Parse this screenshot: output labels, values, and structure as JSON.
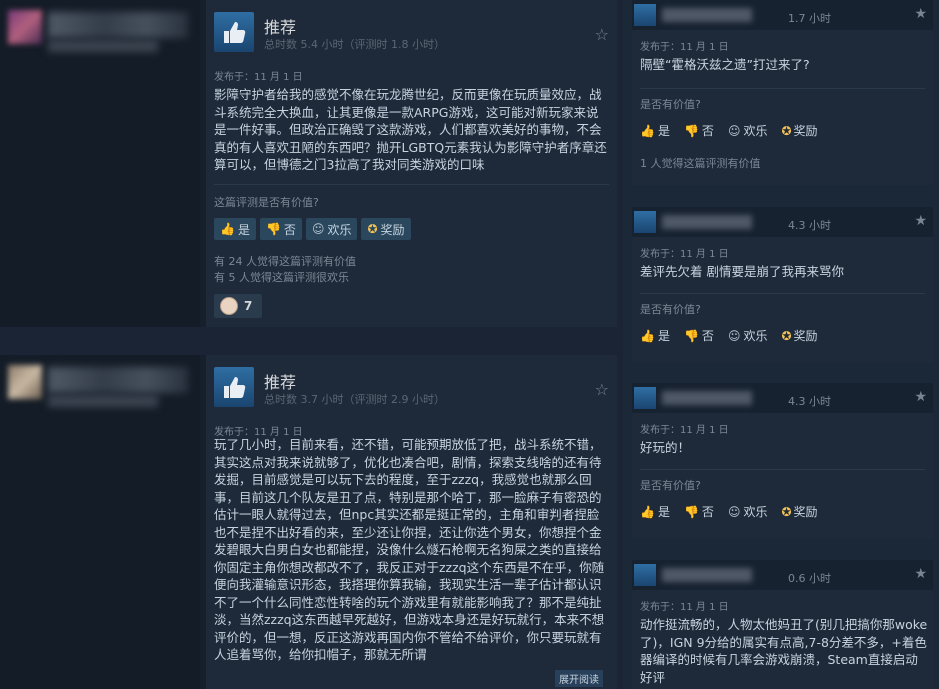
{
  "reviews": [
    {
      "verdict": "推荐",
      "hours": "总时数 5.4 小时（评测时 1.8 小时）",
      "posted": "发布于：11 月 1 日",
      "text": "影障守护者给我的感觉不像在玩龙腾世纪，反而更像在玩质量效应，战斗系统完全大换血，让其更像是一款ARPG游戏，这可能对新玩家来说是一件好事。但政治正确毁了这款游戏，人们都喜欢美好的事物，不会真的有人喜欢丑陋的东西吧？抛开LGBTQ元素我认为影障守护者序章还算可以，但博德之门3拉高了我对同类游戏的口味",
      "helpful_q": "这篇评测是否有价值?",
      "btn_yes": "是",
      "btn_no": "否",
      "btn_funny": "欢乐",
      "btn_award": "奖励",
      "stat1": "有 24 人觉得这篇评测有价值",
      "stat2": "有 5 人觉得这篇评测很欢乐",
      "emoji_count": "7"
    },
    {
      "verdict": "推荐",
      "hours": "总时数 3.7 小时（评测时 2.9 小时）",
      "posted": "发布于：11 月 1 日",
      "text": "玩了几小时，目前来看，还不错，可能预期放低了把，战斗系统不错，其实这点对我来说就够了，优化也凑合吧，剧情，探索支线啥的还有待发掘，目前感觉是可以玩下去的程度，至于zzzq，我感觉也就那么回事，目前这几个队友是丑了点，特别是那个哈丁，那一脸麻子有密恐的估计一眼人就得过去，但npc其实还都是挺正常的，主角和审判者捏脸也不是捏不出好看的来，至少还让你捏，还让你选个男女，你想捏个金发碧眼大白男白女也都能捏，没像什么燧石枪啊无名狗屎之类的直接给你固定主角你想改都改不了，我反正对于zzzq这个东西是不在乎，你随便向我灌输意识形态，我搭理你算我输，我现实生活一辈子估计都认识不了一个什么同性恋性转啥的玩个游戏里有就能影响我了？那不是纯扯淡，当然zzzq这东西越早死越好，但游戏本身还是好玩就行，本来不想评价的，但一想，反正这游戏再国内你不管给不给评价，你只要玩就有人追着骂你，给你扣帽子，那就无所谓",
      "expand": "展开阅读"
    }
  ],
  "cards": [
    {
      "hours": "1.7 小时",
      "posted": "发布于：11 月 1 日",
      "text": "隔壁“霍格沃兹之遗”打过来了?",
      "q": "是否有价值?",
      "yes": "是",
      "no": "否",
      "funny": "欢乐",
      "award": "奖励",
      "stat": "1 人觉得这篇评测有价值"
    },
    {
      "hours": "4.3 小时",
      "posted": "发布于：11 月 1 日",
      "text": "差评先欠着 剧情要是崩了我再来骂你",
      "q": "是否有价值?",
      "yes": "是",
      "no": "否",
      "funny": "欢乐",
      "award": "奖励"
    },
    {
      "hours": "4.3 小时",
      "posted": "发布于：11 月 1 日",
      "text": "好玩的！",
      "q": "是否有价值?",
      "yes": "是",
      "no": "否",
      "funny": "欢乐",
      "award": "奖励"
    },
    {
      "hours": "0.6 小时",
      "posted": "发布于：11 月 1 日",
      "text": "动作挺流畅的，人物太他妈丑了(别几把搞你那woke了)，IGN 9分给的属实有点高,7-8分差不多，+着色器编译的时候有几率会游戏崩溃，Steam直接启动好评"
    }
  ],
  "icons": {
    "thumb": "thumbs-up-icon",
    "star": "star-icon",
    "yes": "thumbs-up-icon",
    "no": "thumbs-down-icon",
    "funny": "smile-icon",
    "award": "award-icon"
  },
  "colors": {
    "accent": "#2a475e",
    "award": "#f5c451"
  }
}
